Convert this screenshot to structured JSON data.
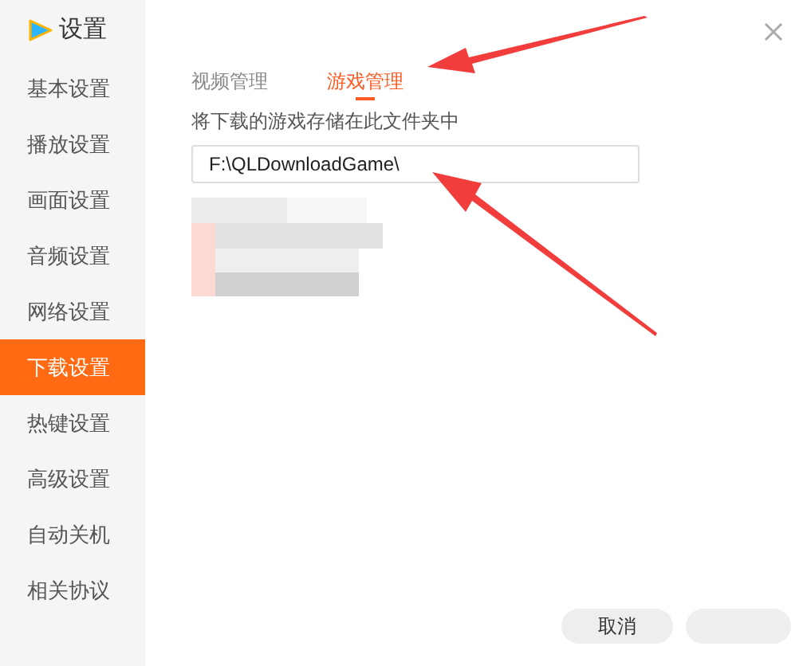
{
  "window": {
    "title": "设置"
  },
  "sidebar": {
    "items": [
      {
        "label": "基本设置",
        "selected": false
      },
      {
        "label": "播放设置",
        "selected": false
      },
      {
        "label": "画面设置",
        "selected": false
      },
      {
        "label": "音频设置",
        "selected": false
      },
      {
        "label": "网络设置",
        "selected": false
      },
      {
        "label": "下载设置",
        "selected": true
      },
      {
        "label": "热键设置",
        "selected": false
      },
      {
        "label": "高级设置",
        "selected": false
      },
      {
        "label": "自动关机",
        "selected": false
      },
      {
        "label": "相关协议",
        "selected": false
      }
    ]
  },
  "tabs": [
    {
      "label": "视频管理",
      "selected": false
    },
    {
      "label": "游戏管理",
      "selected": true
    }
  ],
  "folder": {
    "label": "将下载的游戏存储在此文件夹中",
    "value": "F:\\QLDownloadGame\\"
  },
  "buttons": [
    "取消"
  ]
}
